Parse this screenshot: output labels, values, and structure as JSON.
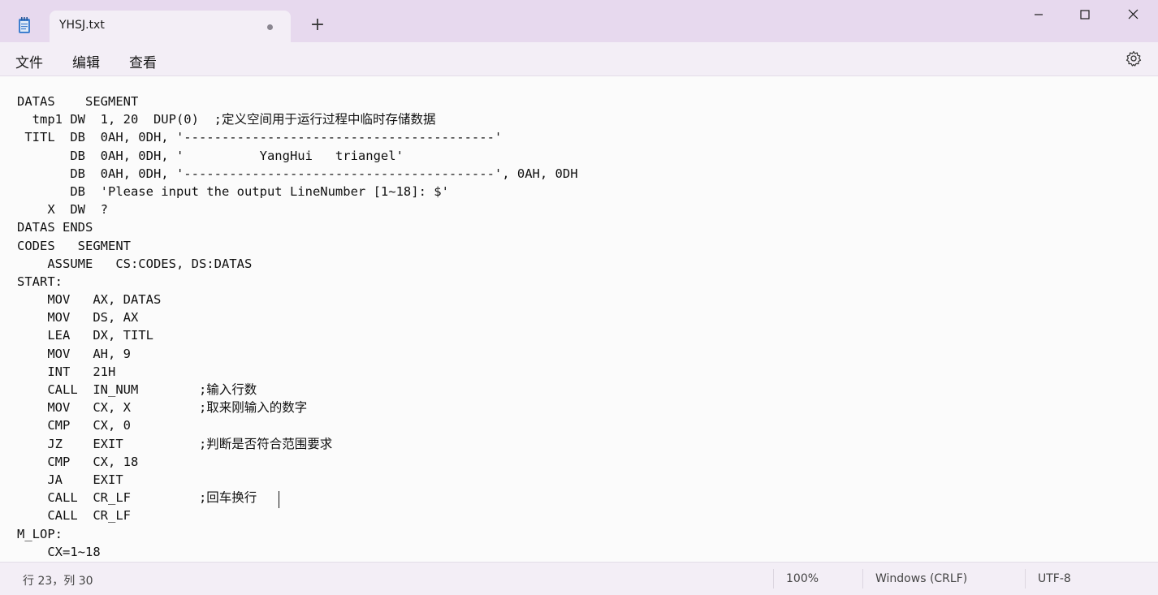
{
  "window": {
    "tab_title": "YHSJ.txt",
    "new_tab": "+"
  },
  "menu": {
    "file": "文件",
    "edit": "编辑",
    "view": "查看"
  },
  "editor": {
    "lines": [
      "DATAS    SEGMENT",
      "  tmp1 DW  1, 20  DUP(0)  ;定义空间用于运行过程中临时存储数据",
      " TITL  DB  0AH, 0DH, '-----------------------------------------'",
      "       DB  0AH, 0DH, '          YangHui   triangel'",
      "       DB  0AH, 0DH, '-----------------------------------------', 0AH, 0DH",
      "       DB  'Please input the output LineNumber [1~18]: $'",
      "    X  DW  ?",
      "DATAS ENDS",
      "CODES   SEGMENT",
      "    ASSUME   CS:CODES, DS:DATAS",
      "START:",
      "    MOV   AX, DATAS",
      "    MOV   DS, AX",
      "    LEA   DX, TITL",
      "    MOV   AH, 9",
      "    INT   21H",
      "    CALL  IN_NUM        ;输入行数",
      "    MOV   CX, X         ;取来刚输入的数字",
      "    CMP   CX, 0",
      "    JZ    EXIT          ;判断是否符合范围要求",
      "    CMP   CX, 18",
      "    JA    EXIT",
      "    CALL  CR_LF         ;回车换行",
      "    CALL  CR_LF",
      "M_LOP:",
      "    CX=1~18"
    ]
  },
  "status": {
    "position": "行 23，列 30",
    "zoom": "100%",
    "line_ending": "Windows (CRLF)",
    "encoding": "UTF-8"
  }
}
